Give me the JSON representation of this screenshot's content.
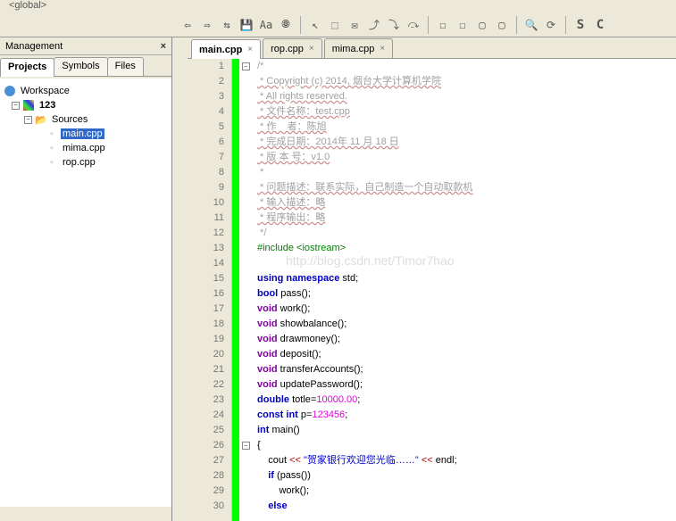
{
  "top_label": "<global>",
  "toolbar": {
    "back": "⇦",
    "fwd": "⇨",
    "swap": "⇆",
    "save": "💾",
    "find": "Aa",
    "bookmark": "🞋",
    "cursor": "↖",
    "select": "⬚",
    "mail": "✉",
    "out": "⤴",
    "in": "⤵",
    "over": "⤼",
    "b1": "☐",
    "b2": "☐",
    "b3": "▢",
    "b4": "▢",
    "zoom": "🔍",
    "refresh": "⟳",
    "s": "S",
    "c": "C"
  },
  "mgmt": {
    "title": "Management",
    "tabs": [
      "Projects",
      "Symbols",
      "Files"
    ],
    "active_tab": 0
  },
  "tree": {
    "workspace": "Workspace",
    "project": "123",
    "folder": "Sources",
    "files": [
      "main.cpp",
      "mima.cpp",
      "rop.cpp"
    ],
    "selected": "main.cpp"
  },
  "editor_tabs": [
    {
      "name": "main.cpp",
      "active": true
    },
    {
      "name": "rop.cpp",
      "active": false
    },
    {
      "name": "mima.cpp",
      "active": false
    }
  ],
  "code": {
    "lines": [
      {
        "n": 1,
        "t": "comment",
        "text": "/*"
      },
      {
        "n": 2,
        "t": "comment",
        "text": " * Copyright (c) 2014, 烟台大学计算机学院",
        "u": true
      },
      {
        "n": 3,
        "t": "comment",
        "text": " * All rights reserved.",
        "u": true
      },
      {
        "n": 4,
        "t": "comment",
        "text": " * 文件名称：test.cpp",
        "u": true
      },
      {
        "n": 5,
        "t": "comment",
        "text": " * 作    者：陈旭",
        "u": true
      },
      {
        "n": 6,
        "t": "comment",
        "text": " * 完成日期：2014年 11 月 18 日",
        "u": true
      },
      {
        "n": 7,
        "t": "comment",
        "text": " * 版 本 号：v1.0",
        "u": true
      },
      {
        "n": 8,
        "t": "comment",
        "text": " *"
      },
      {
        "n": 9,
        "t": "comment",
        "text": " * 问题描述：联系实际，自己制造一个自动取款机",
        "u": true
      },
      {
        "n": 10,
        "t": "comment",
        "text": " * 输入描述：略",
        "u": true
      },
      {
        "n": 11,
        "t": "comment",
        "text": " * 程序输出：略",
        "u": true
      },
      {
        "n": 12,
        "t": "comment",
        "text": " */"
      },
      {
        "n": 13,
        "t": "include",
        "text": "#include <iostream>"
      },
      {
        "n": 14,
        "t": "blank",
        "text": ""
      },
      {
        "n": 15,
        "t": "code",
        "html": "<span class='c-kw'>using</span> <span class='c-kw'>namespace</span> std;"
      },
      {
        "n": 16,
        "t": "code",
        "html": "<span class='c-kw'>bool</span> pass();"
      },
      {
        "n": 17,
        "t": "code",
        "html": "<span class='c-type'>void</span> work();"
      },
      {
        "n": 18,
        "t": "code",
        "html": "<span class='c-type'>void</span> showbalance();"
      },
      {
        "n": 19,
        "t": "code",
        "html": "<span class='c-type'>void</span> drawmoney();"
      },
      {
        "n": 20,
        "t": "code",
        "html": "<span class='c-type'>void</span> deposit();"
      },
      {
        "n": 21,
        "t": "code",
        "html": "<span class='c-type'>void</span> transferAccounts();"
      },
      {
        "n": 22,
        "t": "code",
        "html": "<span class='c-type'>void</span> updatePassword();"
      },
      {
        "n": 23,
        "t": "code",
        "html": "<span class='c-kw'>double</span> totle=<span class='c-num'>10000.00</span>;"
      },
      {
        "n": 24,
        "t": "code",
        "html": "<span class='c-kw'>const</span> <span class='c-kw'>int</span> p=<span class='c-num'>123456</span>;"
      },
      {
        "n": 25,
        "t": "code",
        "html": "<span class='c-kw'>int</span> main()"
      },
      {
        "n": 26,
        "t": "code",
        "html": "{",
        "fold": true
      },
      {
        "n": 27,
        "t": "code",
        "html": "    cout <span class='c-op'>&lt;&lt;</span> <span class='c-str'>\"贺家银行欢迎您光临……\"</span> <span class='c-op'>&lt;&lt;</span> endl;"
      },
      {
        "n": 28,
        "t": "code",
        "html": "    <span class='c-kw'>if</span> (pass())"
      },
      {
        "n": 29,
        "t": "code",
        "html": "        work();"
      },
      {
        "n": 30,
        "t": "code",
        "html": "    <span class='c-kw'>else</span>"
      }
    ]
  },
  "watermark": "http://blog.csdn.net/Timor7hao"
}
